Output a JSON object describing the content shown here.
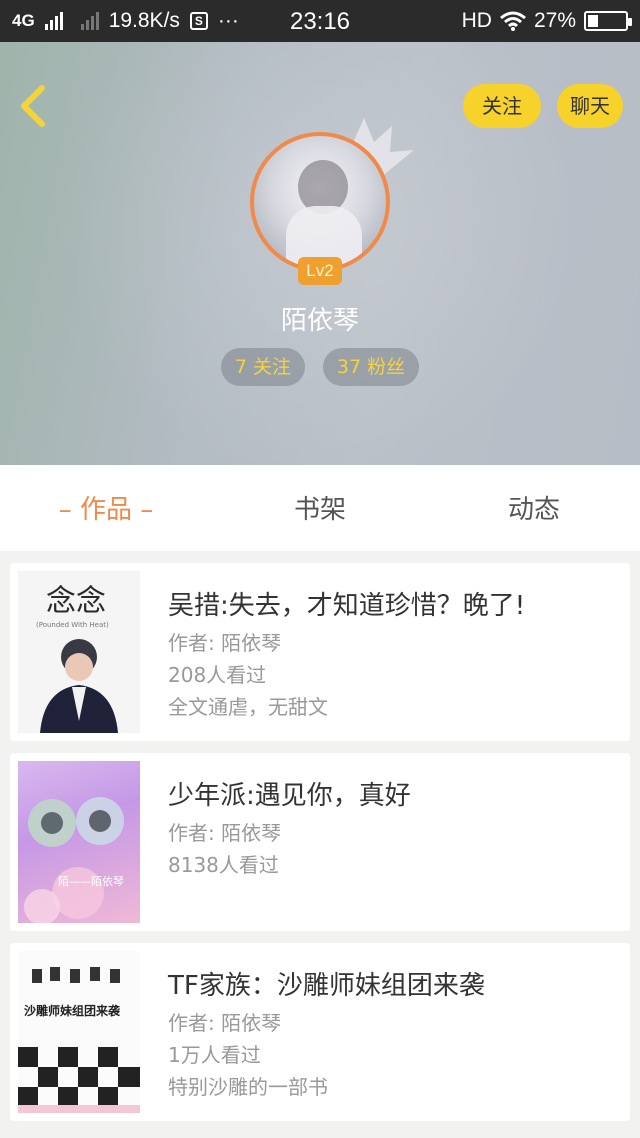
{
  "status_bar": {
    "network": "4G",
    "speed": "19.8K/s",
    "more": "···",
    "time": "23:16",
    "hd": "HD",
    "battery": "27%",
    "battery_level": 0.27
  },
  "header": {
    "follow_label": "关注",
    "chat_label": "聊天",
    "level": "Lv2",
    "username": "陌依琴",
    "following": "7 关注",
    "fans": "37 粉丝",
    "accent_color": "#f7d22a"
  },
  "tabs": [
    {
      "label": "– 作品 –",
      "active": true
    },
    {
      "label": "书架",
      "active": false
    },
    {
      "label": "动态",
      "active": false
    }
  ],
  "books": [
    {
      "title": "吴措:失去，才知道珍惜？晚了!",
      "author": "作者: 陌依琴",
      "views": "208人看过",
      "desc": "全文通虐，无甜文",
      "cover_text": "念念",
      "cover_sub": "(Pounded With Heat)"
    },
    {
      "title": "少年派:遇见你，真好",
      "author": "作者: 陌依琴",
      "views": "8138人看过",
      "desc": "",
      "cover_text": "陌——陌依琴"
    },
    {
      "title": "TF家族：沙雕师妹组团来袭",
      "author": "作者: 陌依琴",
      "views": "1万人看过",
      "desc": "特别沙雕的一部书",
      "cover_text": "沙雕师妹组团来袭"
    }
  ]
}
